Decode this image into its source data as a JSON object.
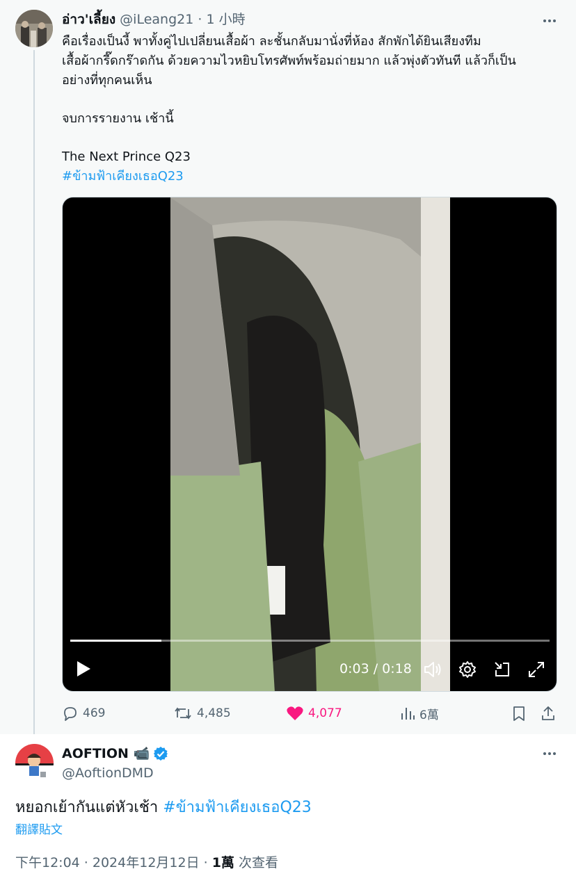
{
  "reply_tweet": {
    "author_name": "อ่าว'เลี้ยง",
    "handle": "@iLeang21",
    "time_ago": "1 小時",
    "text_lines": [
      "คือเรื่องเป็นงี้ พาทั้งคู่ไปเปลี่ยนเสื้อผ้า ละชั้นกลับมานั่งที่ห้อง สักพักได้ยินเสียงทีม",
      "เสื้อผ้ากรี๊ดกร๊าดกัน ด้วยความไวหยิบโทรศัพท์พร้อมถ่ายมาก แล้วพุ่งตัวทันที แล้วก็เป็น",
      "อย่างที่ทุกคนเห็น",
      "จบการรายงาน เช้านี้",
      "The Next Prince Q23"
    ],
    "hashtag": "#ข้ามฟ้าเคียงเธอQ23",
    "video": {
      "time_display": "0:03 / 0:18",
      "progress": 0.19
    },
    "stats": {
      "replies": "469",
      "retweets": "4,485",
      "likes": "4,077",
      "views": "6萬"
    },
    "colors": {
      "like": "#f91880",
      "link": "#1d9bf0",
      "muted": "#536471"
    }
  },
  "main_tweet": {
    "author_name": "AOFTION",
    "name_emoji": "📹",
    "verified": true,
    "handle": "@AoftionDMD",
    "text": "หยอกเย้ากันแต่หัวเช้า",
    "hashtag": "#ข้ามฟ้าเคียงเธอQ23",
    "translate_label": "翻譯貼文",
    "timestamp": "下午12:04 · 2024年12月12日 · ",
    "views_count": "1萬",
    "views_label": " 次查看"
  }
}
